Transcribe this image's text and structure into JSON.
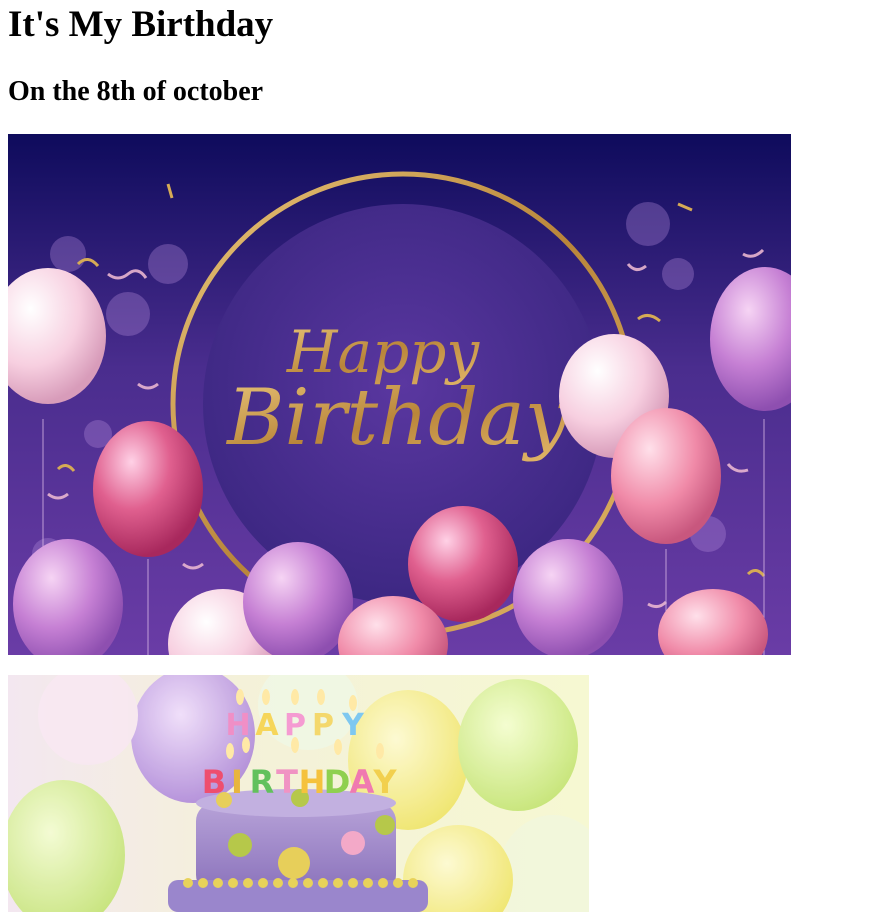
{
  "page": {
    "title": "It's My Birthday",
    "subtitle": "On the 8th of october"
  },
  "images": {
    "banner": {
      "text_line1": "Happy",
      "text_line2": "Birthday"
    },
    "cake": {
      "candles_line1": [
        "H",
        "A",
        "P",
        "P",
        "Y"
      ],
      "candles_line2": [
        "B",
        "I",
        "R",
        "T",
        "H",
        "D",
        "A",
        "Y"
      ]
    }
  },
  "colors": {
    "banner_bg_top": "#0e0b5c",
    "banner_bg_bottom": "#6a3ca6",
    "gold": "#c79a45",
    "cake_purple": "#9c86c8"
  }
}
